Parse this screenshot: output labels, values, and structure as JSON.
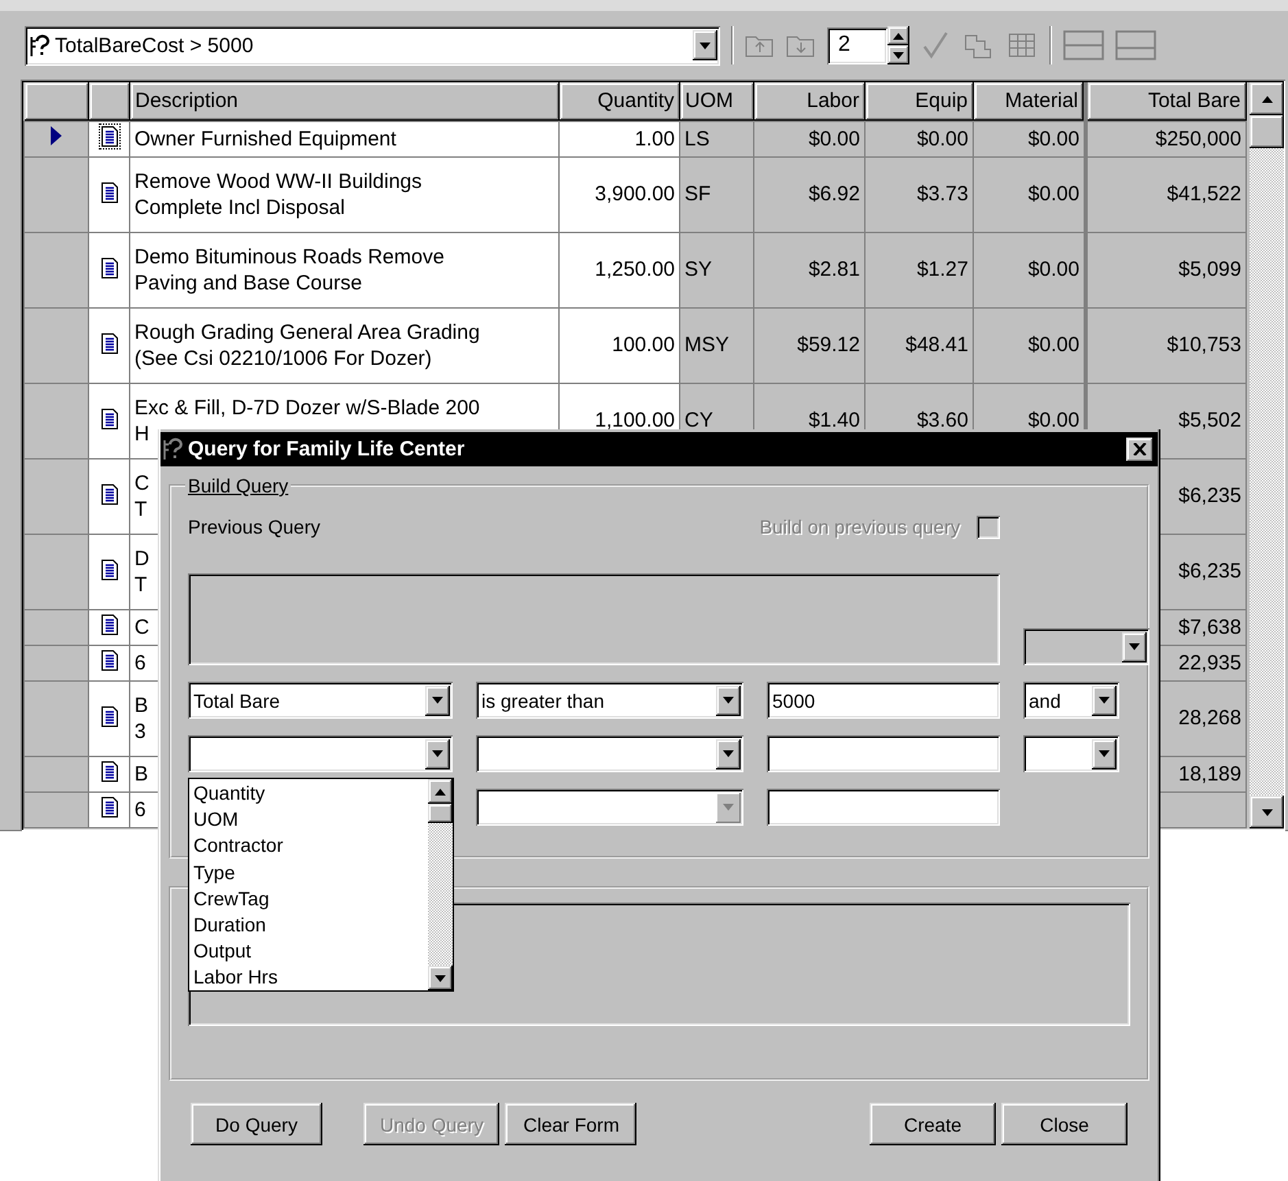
{
  "query_bar": {
    "query": "TotalBareCost > 5000",
    "page": "2"
  },
  "grid": {
    "columns": [
      {
        "label": "Description",
        "kind": "text",
        "editable": true
      },
      {
        "label": "Quantity",
        "kind": "number",
        "editable": true
      },
      {
        "label": "UOM",
        "kind": "text",
        "editable": false
      },
      {
        "label": "Labor",
        "kind": "number",
        "editable": false
      },
      {
        "label": "Equip",
        "kind": "number",
        "editable": false
      },
      {
        "label": "Material",
        "kind": "number",
        "editable": false
      },
      {
        "label": "Total Bare",
        "kind": "number",
        "editable": false
      }
    ],
    "rows": [
      {
        "selected": true,
        "description": [
          "Owner Furnished Equipment"
        ],
        "quantity": "1.00",
        "uom": "LS",
        "labor": "$0.00",
        "equip": "$0.00",
        "material": "$0.00",
        "total_bare": "$250,000"
      },
      {
        "selected": false,
        "description": [
          "Remove Wood WW-II Buildings",
          "Complete Incl Disposal"
        ],
        "quantity": "3,900.00",
        "uom": "SF",
        "labor": "$6.92",
        "equip": "$3.73",
        "material": "$0.00",
        "total_bare": "$41,522"
      },
      {
        "selected": false,
        "description": [
          "Demo Bituminous Roads Remove",
          "Paving and Base Course"
        ],
        "quantity": "1,250.00",
        "uom": "SY",
        "labor": "$2.81",
        "equip": "$1.27",
        "material": "$0.00",
        "total_bare": "$5,099"
      },
      {
        "selected": false,
        "description": [
          "Rough Grading General Area Grading",
          "(See Csi 02210/1006 For Dozer)"
        ],
        "quantity": "100.00",
        "uom": "MSY",
        "labor": "$59.12",
        "equip": "$48.41",
        "material": "$0.00",
        "total_bare": "$10,753"
      },
      {
        "selected": false,
        "description": [
          "Exc & Fill, D-7D Dozer w/S-Blade 200",
          "H"
        ],
        "quantity": "1,100.00",
        "uom": "CY",
        "labor": "$1.40",
        "equip": "$3.60",
        "material": "$0.00",
        "total_bare": "$5,502"
      },
      {
        "selected": false,
        "description": [
          "C",
          "T"
        ],
        "total_bare": "$6,235"
      },
      {
        "selected": false,
        "description": [
          "D",
          "T"
        ],
        "total_bare": "$6,235"
      },
      {
        "selected": false,
        "description": [
          "C"
        ],
        "total_bare": "$7,638"
      },
      {
        "selected": false,
        "description": [
          "6"
        ],
        "total_bare": "22,935"
      },
      {
        "selected": false,
        "description": [
          "B",
          "3"
        ],
        "total_bare": "28,268"
      },
      {
        "selected": false,
        "description": [
          "B"
        ],
        "total_bare": "18,189"
      },
      {
        "selected": false,
        "description": [
          "6"
        ]
      }
    ]
  },
  "dialog": {
    "title": "Query for Family Life Center",
    "build_query": {
      "label": "Build Query",
      "previous_query_label": "Previous Query",
      "build_on_previous": {
        "label": "Build on previous query",
        "checked": false,
        "disabled": true
      },
      "previous_connector": true,
      "conditions": [
        {
          "field": "Total Bare",
          "operator": "is greater than",
          "value": "5000",
          "connector": "and",
          "has_connector": true,
          "operator_disabled": false
        },
        {
          "has_connector": true,
          "operator_disabled": false
        },
        {
          "has_connector": false,
          "operator_disabled": true
        }
      ]
    },
    "field_list": {
      "items": [
        {
          "label": "Quantity",
          "selected": false
        },
        {
          "label": "UOM",
          "selected": false
        },
        {
          "label": "Contractor",
          "selected": false
        },
        {
          "label": "Type",
          "selected": false
        },
        {
          "label": "CrewTag",
          "selected": false
        },
        {
          "label": "Duration",
          "selected": false
        },
        {
          "label": "Output",
          "selected": false
        },
        {
          "label": "Labor Hrs",
          "selected": false
        }
      ]
    },
    "left_buttons": [
      {
        "label": "Do Query",
        "disabled": false
      },
      {
        "label": "Undo Query",
        "disabled": true
      },
      {
        "label": "Clear Form",
        "disabled": false
      }
    ],
    "right_buttons": [
      {
        "label": "Create",
        "disabled": false
      },
      {
        "label": "Close",
        "disabled": false
      }
    ]
  }
}
